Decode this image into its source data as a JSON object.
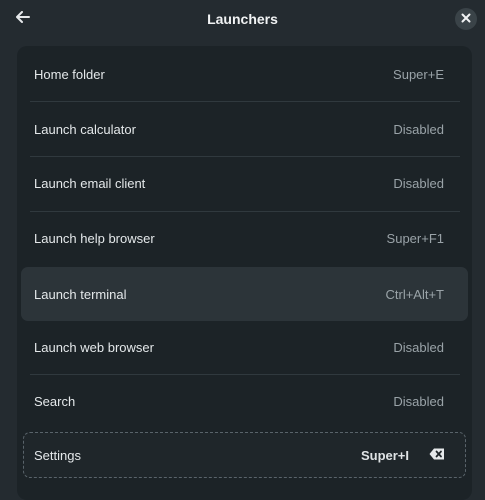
{
  "header": {
    "title": "Launchers",
    "back_icon": "arrow-left-icon",
    "close_icon": "close-icon"
  },
  "shortcuts": [
    {
      "label": "Home folder",
      "accel": "Super+E"
    },
    {
      "label": "Launch calculator",
      "accel": "Disabled"
    },
    {
      "label": "Launch email client",
      "accel": "Disabled"
    },
    {
      "label": "Launch help browser",
      "accel": "Super+F1"
    },
    {
      "label": "Launch terminal",
      "accel": "Ctrl+Alt+T"
    },
    {
      "label": "Launch web browser",
      "accel": "Disabled"
    },
    {
      "label": "Search",
      "accel": "Disabled"
    },
    {
      "label": "Settings",
      "accel": "Super+I",
      "clear_icon": "backspace-clear-icon"
    }
  ],
  "colors": {
    "background": "#242b30",
    "list_background": "#1c2327",
    "hover_row": "#2c3439",
    "text": "#e4e8ea",
    "muted_text": "#9aa3a8"
  }
}
